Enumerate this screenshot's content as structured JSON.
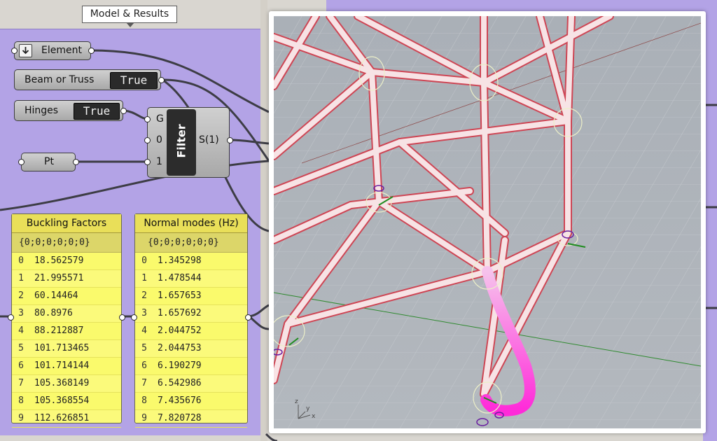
{
  "tooltip": "Model & Results",
  "components": {
    "element": "Element",
    "beam_or_truss": {
      "label": "Beam or Truss",
      "value": "True"
    },
    "hinges": {
      "label": "Hinges",
      "value": "True"
    },
    "pt": "Pt",
    "filter": {
      "title": "Filter",
      "inputs": [
        "G",
        "0",
        "1"
      ],
      "output": "S(1)"
    }
  },
  "panels": [
    {
      "title": "Buckling Factors",
      "path": "{0;0;0;0;0;0}",
      "rows": [
        {
          "i": "0",
          "v": "18.562579"
        },
        {
          "i": "1",
          "v": "21.995571"
        },
        {
          "i": "2",
          "v": "60.14464"
        },
        {
          "i": "3",
          "v": "80.8976"
        },
        {
          "i": "4",
          "v": "88.212887"
        },
        {
          "i": "5",
          "v": "101.713465"
        },
        {
          "i": "6",
          "v": "101.714144"
        },
        {
          "i": "7",
          "v": "105.368149"
        },
        {
          "i": "8",
          "v": "105.368554"
        },
        {
          "i": "9",
          "v": "112.626851"
        }
      ]
    },
    {
      "title": "Normal modes (Hz)",
      "path": "{0;0;0;0;0;0}",
      "rows": [
        {
          "i": "0",
          "v": "1.345298"
        },
        {
          "i": "1",
          "v": "1.478544"
        },
        {
          "i": "2",
          "v": "1.657653"
        },
        {
          "i": "3",
          "v": "1.657692"
        },
        {
          "i": "4",
          "v": "2.044752"
        },
        {
          "i": "5",
          "v": "2.044753"
        },
        {
          "i": "6",
          "v": "6.190279"
        },
        {
          "i": "7",
          "v": "6.542986"
        },
        {
          "i": "8",
          "v": "7.435676"
        },
        {
          "i": "9",
          "v": "7.820728"
        }
      ]
    }
  ],
  "viewport": {
    "axis_labels": {
      "z": "z",
      "y": "y",
      "x": "x"
    }
  },
  "colors": {
    "group_fill": "#b3a3e6",
    "panel_fill": "#fbfa7b",
    "beam_color": "#d63a4a",
    "deformed_color": "#ff33dd"
  },
  "icons": {
    "element_dropdown": "chevron-down-icon"
  }
}
